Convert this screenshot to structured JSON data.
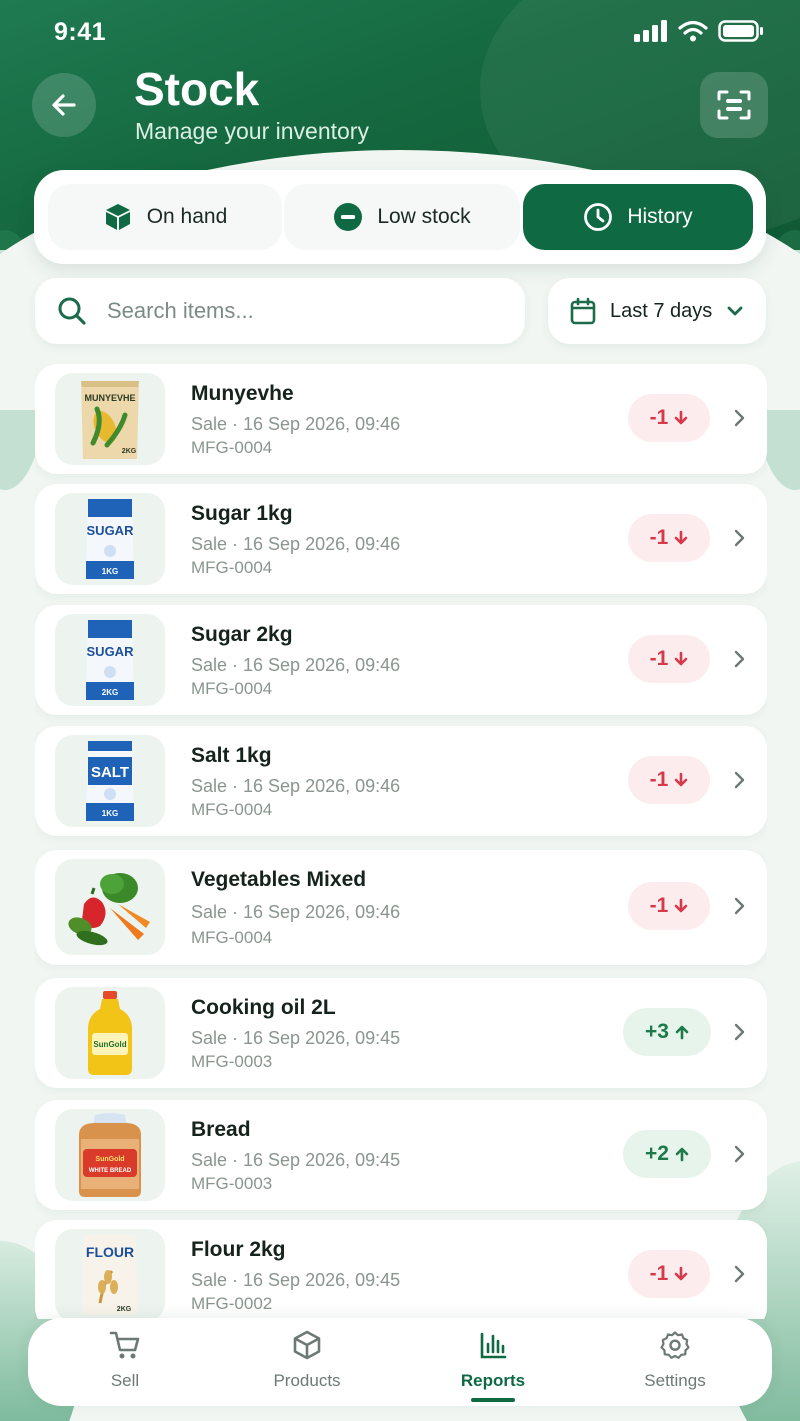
{
  "status_bar": {
    "time": "9:41"
  },
  "header": {
    "title": "Stock",
    "subtitle": "Manage your inventory"
  },
  "tabs": [
    {
      "label": "On hand",
      "icon": "box-icon",
      "active": false
    },
    {
      "label": "Low stock",
      "icon": "minus-circle-icon",
      "active": false
    },
    {
      "label": "History",
      "icon": "clock-icon",
      "active": true
    }
  ],
  "search": {
    "placeholder": "Search items..."
  },
  "date_filter": {
    "label": "Last 7 days"
  },
  "history": [
    {
      "name": "Munyevhe",
      "meta": "Sale · 16 Sep 2026, 09:46",
      "ref": "MFG-0004",
      "qty": "-1",
      "direction": "down",
      "thumb": "maize-bag",
      "thumb_label": "MUNYEVHE",
      "thumb_weight": "2KG"
    },
    {
      "name": "Sugar 1kg",
      "meta": "Sale · 16 Sep 2026, 09:46",
      "ref": "MFG-0004",
      "qty": "-1",
      "direction": "down",
      "thumb": "sugar-bag",
      "thumb_label": "SUGAR",
      "thumb_weight": "1KG"
    },
    {
      "name": "Sugar 2kg",
      "meta": "Sale · 16 Sep 2026, 09:46",
      "ref": "MFG-0004",
      "qty": "-1",
      "direction": "down",
      "thumb": "sugar-bag",
      "thumb_label": "SUGAR",
      "thumb_weight": "2KG"
    },
    {
      "name": "Salt 1kg",
      "meta": "Sale · 16 Sep 2026, 09:46",
      "ref": "MFG-0004",
      "qty": "-1",
      "direction": "down",
      "thumb": "salt-bag",
      "thumb_label": "SALT",
      "thumb_weight": "1KG"
    },
    {
      "name": "Vegetables Mixed",
      "meta": "Sale · 16 Sep 2026, 09:46",
      "ref": "MFG-0004",
      "qty": "-1",
      "direction": "down",
      "thumb": "vegetables"
    },
    {
      "name": "Cooking oil 2L",
      "meta": "Sale · 16 Sep 2026, 09:45",
      "ref": "MFG-0003",
      "qty": "+3",
      "direction": "up",
      "thumb": "oil-bottle",
      "thumb_label": "SunGold"
    },
    {
      "name": "Bread",
      "meta": "Sale · 16 Sep 2026, 09:45",
      "ref": "MFG-0003",
      "qty": "+2",
      "direction": "up",
      "thumb": "bread-loaf",
      "thumb_label": "SunGold",
      "thumb_sub": "WHITE BREAD"
    },
    {
      "name": "Flour 2kg",
      "meta": "Sale · 16 Sep 2026, 09:45",
      "ref": "MFG-0002",
      "qty": "-1",
      "direction": "down",
      "thumb": "flour-bag",
      "thumb_label": "FLOUR",
      "thumb_weight": "2KG"
    }
  ],
  "bottom_nav": [
    {
      "label": "Sell",
      "icon": "cart-icon",
      "active": false
    },
    {
      "label": "Products",
      "icon": "cube-icon",
      "active": false
    },
    {
      "label": "Reports",
      "icon": "bar-chart-icon",
      "active": true
    },
    {
      "label": "Settings",
      "icon": "gear-icon",
      "active": false
    }
  ],
  "colors": {
    "brand": "#0f6a44",
    "negative": "#d63a4a",
    "positive": "#1c7a4a"
  }
}
